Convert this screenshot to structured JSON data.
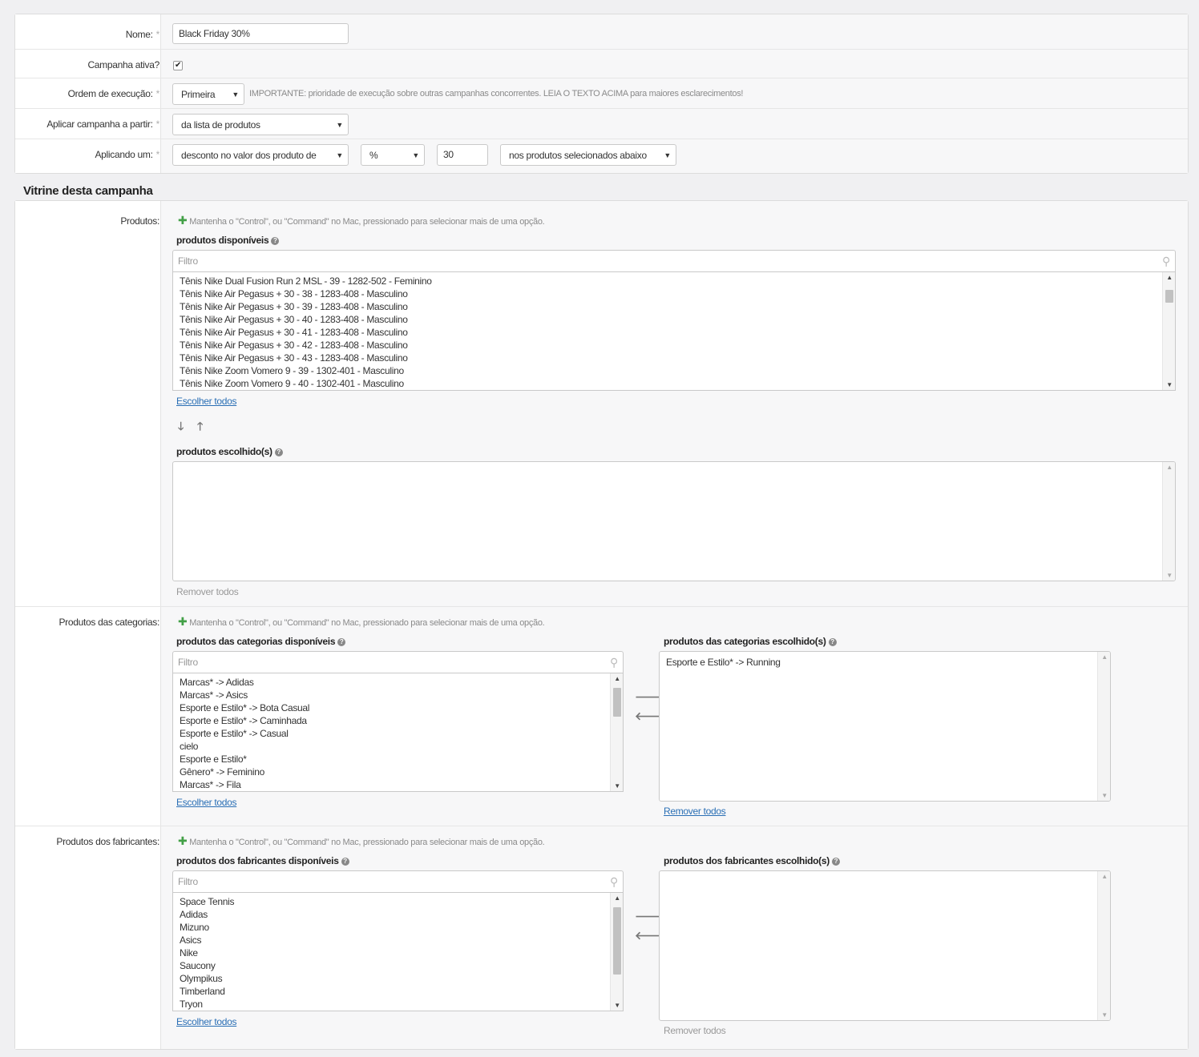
{
  "form": {
    "name_label": "Nome:",
    "name_value": "Black Friday 30%",
    "active_label": "Campanha ativa?",
    "active_checked": true,
    "order_label": "Ordem de execução:",
    "order_value": "Primeira",
    "order_note": "IMPORTANTE: prioridade de execução sobre outras campanhas concorrentes. LEIA O TEXTO ACIMA para maiores esclarecimentos!",
    "apply_from_label": "Aplicar campanha a partir:",
    "apply_from_value": "da lista de produtos",
    "applying_label": "Aplicando um:",
    "discount_type_value": "desconto no valor dos produto de",
    "unit_value": "%",
    "amount_value": "30",
    "target_value": "nos produtos selecionados abaixo",
    "required_mark": "*"
  },
  "showcase": {
    "title": "Vitrine desta campanha",
    "hint": "Mantenha o \"Control\", ou \"Command\" no Mac, pressionado para selecionar mais de uma opção.",
    "filter_placeholder": "Filtro",
    "select_all": "Escolher todos",
    "remove_all": "Remover todos",
    "products": {
      "label": "Produtos:",
      "available_title": "produtos disponíveis",
      "chosen_title": "produtos escolhido(s)",
      "available": [
        "Tênis Nike Dual Fusion Run 2 MSL - 39 - 1282-502 - Feminino",
        "Tênis Nike Air Pegasus + 30 - 38 - 1283-408 - Masculino",
        "Tênis Nike Air Pegasus + 30 - 39 - 1283-408 - Masculino",
        "Tênis Nike Air Pegasus + 30 - 40 - 1283-408 - Masculino",
        "Tênis Nike Air Pegasus + 30 - 41 - 1283-408 - Masculino",
        "Tênis Nike Air Pegasus + 30 - 42 - 1283-408 - Masculino",
        "Tênis Nike Air Pegasus + 30 - 43 - 1283-408 - Masculino",
        "Tênis Nike Zoom Vomero 9 - 39 - 1302-401 - Masculino",
        "Tênis Nike Zoom Vomero 9 - 40 - 1302-401 - Masculino"
      ],
      "chosen": []
    },
    "categories": {
      "label": "Produtos das categorias:",
      "available_title": "produtos das categorias disponíveis",
      "chosen_title": "produtos das categorias escolhido(s)",
      "available": [
        "Marcas* -> Adidas",
        "Marcas* -> Asics",
        "Esporte e Estilo* -> Bota Casual",
        "Esporte e Estilo* -> Caminhada",
        "Esporte e Estilo* -> Casual",
        "cielo",
        "Esporte e Estilo*",
        "Gênero* -> Feminino",
        "Marcas* -> Fila"
      ],
      "chosen": [
        "Esporte e Estilo* -> Running"
      ]
    },
    "manufacturers": {
      "label": "Produtos dos fabricantes:",
      "available_title": "produtos dos fabricantes disponíveis",
      "chosen_title": "produtos dos fabricantes escolhido(s)",
      "available": [
        "Space Tennis",
        "Adidas",
        "Mizuno",
        "Asics",
        "Nike",
        "Saucony",
        "Olympikus",
        "Timberland",
        "Tryon"
      ],
      "chosen": []
    }
  }
}
